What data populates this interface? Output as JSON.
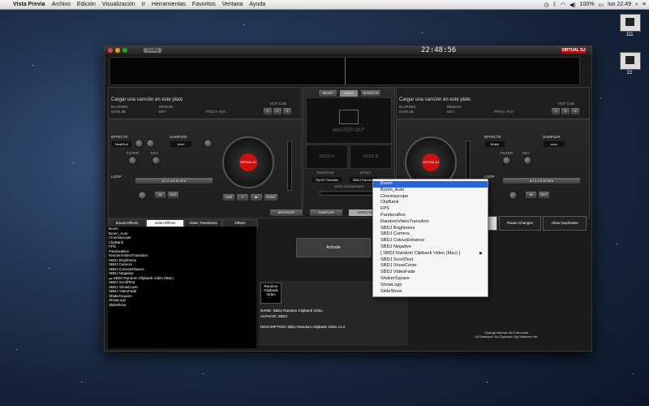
{
  "menubar": {
    "app_name": "Vista Previa",
    "items": [
      "Archivo",
      "Edición",
      "Visualización",
      "Ir",
      "Herramientas",
      "Favoritos",
      "Ventana",
      "Ayuda"
    ],
    "battery": "100%",
    "clock": "lun 22:49"
  },
  "desktop": {
    "icon1_label": "111",
    "icon2_label": "22"
  },
  "app": {
    "config_label": "Config",
    "clock": "22:48:56",
    "logo": "VIRTUAL DJ",
    "deck_left": {
      "title": "Cargar una canción en este plato",
      "elapsed": "ELAPSED",
      "remain": "REMAIN",
      "gain": "GAIN dB",
      "key": "KEY",
      "pitch": "PITCH +0.0",
      "hotcue": "HOT CUE",
      "effects": "EFFECTS",
      "effect_value": "BeatGrid",
      "sampler": "SAMPLER",
      "sampler_value": "siren",
      "filter": "FILTER",
      "key_label": "KEY",
      "loop": "LOOP",
      "platter_label": "VIRTUAL DJ",
      "cue": "CUE",
      "play": "▶",
      "sync": "SYNC",
      "in": "IN",
      "out": "OUT"
    },
    "deck_right": {
      "title": "Cargar una canción en este plato",
      "elapsed": "ELAPSED",
      "remain": "REMAIN",
      "gain": "GAIN dB",
      "key": "KEY",
      "pitch": "PITCH +0.0",
      "hotcue": "HOT CUE",
      "effects": "EFFECTS",
      "effect_value": "Brake",
      "sampler": "SAMPLER",
      "sampler_value": "siren",
      "filter": "FILTER",
      "key_label": "KEY",
      "loop": "LOOP",
      "platter_label": "VIRTUAL DJ",
      "in": "IN",
      "out": "OUT"
    },
    "center": {
      "tabs": [
        "MIXER",
        "VIDEO",
        "SCRATCH"
      ],
      "master_out": "MASTER OUT",
      "deck_a": "DECK A",
      "deck_b": "DECK B",
      "transition_value": "Flip3D Transitio",
      "effect_value": "SBDJ Random",
      "crossfader": "VIDEO CROSSFADER",
      "transition_label": "TRANSITION",
      "effect_label": "EFFECT"
    },
    "bottom_tabs": [
      "BROWSER",
      "SAMPLER",
      "EFFECTS"
    ],
    "effect_tabs": [
      "Sound Effects",
      "Video Effects",
      "Video Transitions",
      "Others"
    ],
    "effects_list": [
      "Boom",
      "Boom_Auto",
      "Cinemascope",
      "ClipBank",
      "FPS",
      "PandoraBox",
      "RandomVideoTransition",
      "SBDJ Brightness",
      "SBDJ Camera",
      "SBDJ ColourEnhance",
      "SBDJ Negative",
      "SBDJ Random Clipbank Video (Mac)",
      "SBDJ ScrollText",
      "SBDJ ShowCover",
      "SBDJ VideoFade",
      "ShakerSquare",
      "ShowLogo",
      "SlideShow"
    ],
    "activate_button": "Activate",
    "info": {
      "thumb_text": "Random Clipbank Video",
      "name": "NAME: SBDJ Random Clipbank Video",
      "author": "AUTHOR: SBDJ",
      "description": "DESCRIPTION: SBDJ Random Clipbank Video v1.2"
    },
    "pause_changes": "Pause Changes",
    "allow_duplicates": "Allow Duplicates",
    "status_line1": "Change interval: 66.0 seconds",
    "status_line2": "v0 Detected. No Clipbank Clip Selected Yet"
  },
  "dropdown": {
    "items": [
      "Boom",
      "Boom_Auto",
      "Cinemascope",
      "ClipBank",
      "FPS",
      "PandoraBox",
      "RandomVideoTransition",
      "SBDJ Brightness",
      "SBDJ Camera",
      "SBDJ ColourEnhance",
      "SBDJ Negative",
      "[ SBDJ Random Clipbank Video (Mac) ]",
      "SBDJ ScrollText",
      "SBDJ ShowCover",
      "SBDJ VideoFade",
      "ShakerSquare",
      "ShowLogo",
      "SlideShow"
    ],
    "selected_index": 0,
    "submenu_arrow": "▶"
  }
}
